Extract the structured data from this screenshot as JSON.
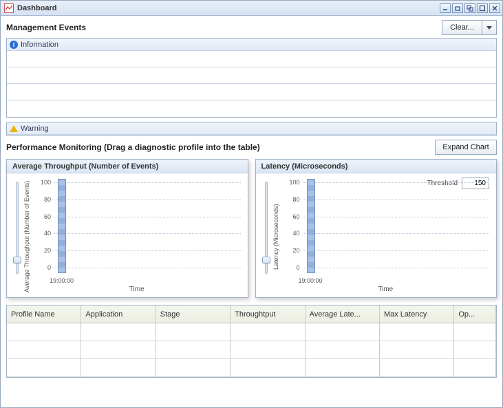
{
  "window": {
    "title": "Dashboard"
  },
  "management": {
    "title": "Management Events",
    "clear_label": "Clear...",
    "info_label": "Information",
    "warn_label": "Warning"
  },
  "perf": {
    "title": "Performance Monitoring (Drag a diagnostic profile into the table)",
    "expand_label": "Expand Chart"
  },
  "charts": {
    "throughput": {
      "title": "Average Throughput (Number of Events)",
      "ylabel": "Average Throughput (Number of Events)",
      "xlabel": "Time",
      "xtick": "19:00:00"
    },
    "latency": {
      "title": "Latency (Microseconds)",
      "ylabel": "Latency (Microseconds)",
      "xlabel": "Time",
      "xtick": "19:00:00",
      "threshold_label": "Threshold",
      "threshold_value": "150"
    },
    "yticks": [
      "100",
      "80",
      "60",
      "40",
      "20",
      "0"
    ]
  },
  "chart_data": [
    {
      "type": "bar",
      "title": "Average Throughput (Number of Events)",
      "xlabel": "Time",
      "ylabel": "Average Throughput (Number of Events)",
      "ylim": [
        0,
        100
      ],
      "categories": [
        "19:00:00"
      ],
      "values": [
        null
      ]
    },
    {
      "type": "bar",
      "title": "Latency (Microseconds)",
      "xlabel": "Time",
      "ylabel": "Latency (Microseconds)",
      "ylim": [
        0,
        100
      ],
      "threshold": 150,
      "categories": [
        "19:00:00"
      ],
      "values": [
        null
      ]
    }
  ],
  "table": {
    "columns": [
      "Profile Name",
      "Application",
      "Stage",
      "Throughtput",
      "Average Late...",
      "Max Latency",
      "Op..."
    ]
  }
}
